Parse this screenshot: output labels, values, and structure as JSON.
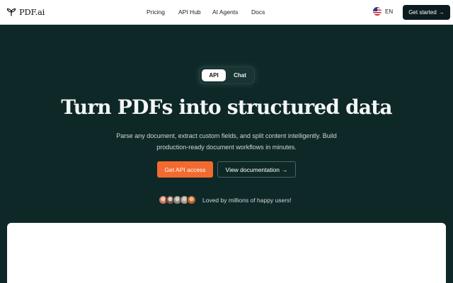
{
  "nav": {
    "logo_text": "PDF.ai",
    "links": [
      "Pricing",
      "API Hub",
      "AI Agents",
      "Docs"
    ],
    "language": "EN",
    "cta_label": "Get started",
    "cta_arrow": "→"
  },
  "hero": {
    "toggle": {
      "active": "API",
      "inactive": "Chat"
    },
    "headline": "Turn PDFs into structured data",
    "subtext": "Parse any document, extract custom fields, and split content intelligently. Build production-ready document workflows in minutes.",
    "primary_button": "Get API access",
    "secondary_button": "View documentation",
    "secondary_arrow": "→",
    "social_proof": "Loved by millions of happy users!"
  },
  "icons": {
    "logo": "leaf-logo-icon",
    "flag": "us-flag-icon",
    "arrow": "arrow-right-icon"
  },
  "colors": {
    "hero_background": "#0e2828",
    "accent": "#f26a30",
    "nav_cta_background": "#0b1b1f"
  }
}
